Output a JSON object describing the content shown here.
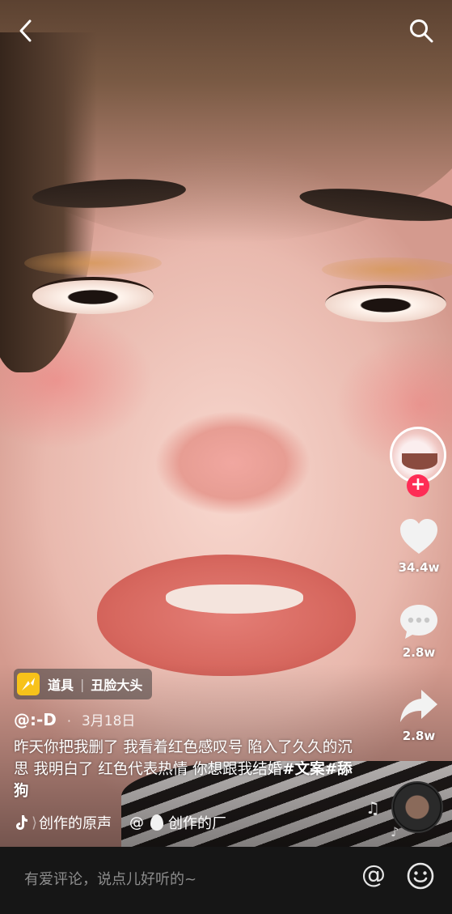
{
  "header": {
    "back_icon": "back-arrow-icon",
    "search_icon": "search-icon"
  },
  "sidebar": {
    "follow_label": "+",
    "like_count": "34.4w",
    "comment_count": "2.8w",
    "share_count": "2.8w"
  },
  "prop": {
    "label": "道具",
    "name": "丑脸大头"
  },
  "post": {
    "author": "@:-D",
    "date": "3月18日",
    "caption_text": "昨天你把我删了 我看着红色感叹号 陷入了久久的沉思 我明白了 红色代表热情 你想跟我结婚",
    "hashtags": [
      "#文案",
      "#舔狗"
    ]
  },
  "music": {
    "original_sound": "创作的原声",
    "credit_prefix": "@",
    "credit_text": "创作的厂"
  },
  "comment_bar": {
    "placeholder": "有爱评论，说点儿好听的~",
    "at_symbol": "@"
  },
  "colors": {
    "accent": "#fe2c55",
    "prop_icon": "#f7c21a",
    "comment_bar_bg": "#161616"
  }
}
